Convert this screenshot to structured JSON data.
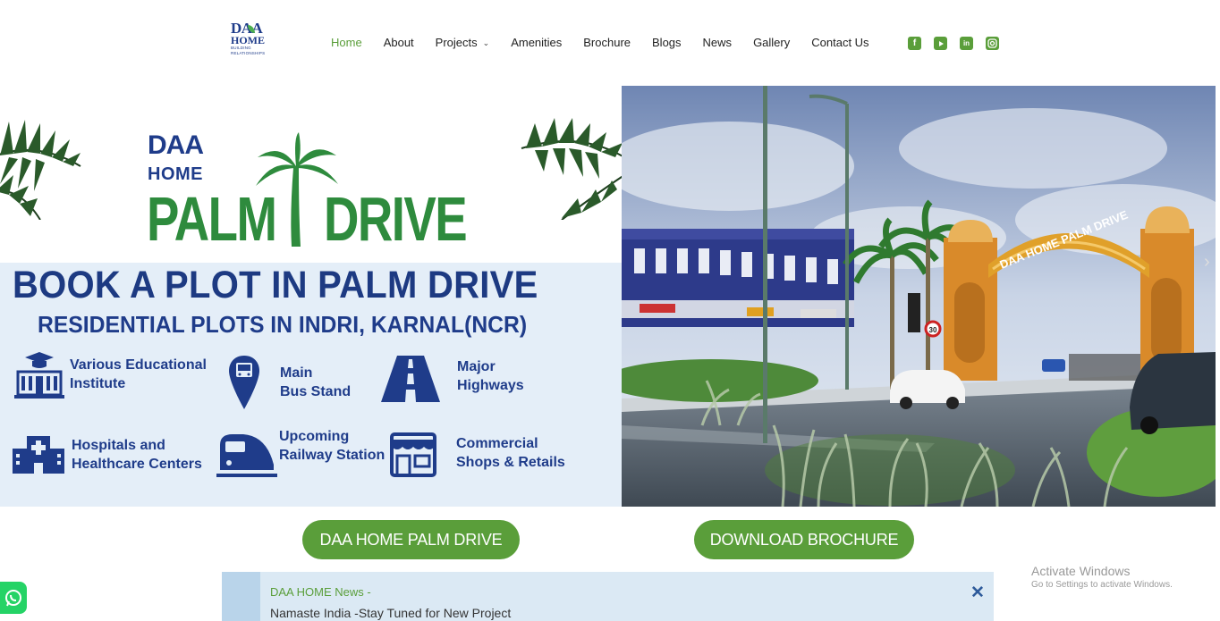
{
  "header": {
    "logo": {
      "line1": "DAA",
      "line2": "HOME",
      "tagline": "BUILDING RELATIONSHIPS"
    },
    "nav": [
      {
        "label": "Home",
        "active": true
      },
      {
        "label": "About"
      },
      {
        "label": "Projects",
        "dropdown": true
      },
      {
        "label": "Amenities"
      },
      {
        "label": "Brochure"
      },
      {
        "label": "Blogs"
      },
      {
        "label": "News"
      },
      {
        "label": "Gallery"
      },
      {
        "label": "Contact Us"
      }
    ],
    "social_icons": [
      "facebook-icon",
      "youtube-icon",
      "linkedin-icon",
      "instagram-icon"
    ],
    "accent_color": "#5a9e3a"
  },
  "banner": {
    "brand_top": "DAA",
    "brand_home": "HOME",
    "brand_palm": "PALM",
    "brand_drive": "DRIVE",
    "headline": "BOOK A PLOT IN PALM DRIVE",
    "subheadline": "RESIDENTIAL PLOTS IN INDRI, KARNAL(NCR)",
    "features": [
      {
        "icon": "school-icon",
        "line1": "Various Educational",
        "line2": "Institute"
      },
      {
        "icon": "bus-stand-icon",
        "line1": "Main",
        "line2": "Bus Stand"
      },
      {
        "icon": "highway-icon",
        "line1": "Major",
        "line2": "Highways"
      },
      {
        "icon": "hospital-icon",
        "line1": "Hospitals and",
        "line2": "Healthcare Centers"
      },
      {
        "icon": "train-icon",
        "line1": "Upcoming",
        "line2": "Railway Station"
      },
      {
        "icon": "shop-icon",
        "line1": "Commercial",
        "line2": "Shops & Retails"
      }
    ],
    "gate_sign": "DAA HOME PALM DRIVE",
    "speed_sign": "30"
  },
  "cta": {
    "primary": "DAA HOME PALM DRIVE",
    "secondary": "DOWNLOAD BROCHURE"
  },
  "news": {
    "title": "DAA HOME News -",
    "text": "Namaste India -Stay Tuned for New Project",
    "close": "✕"
  },
  "watermark": {
    "line1": "Activate Windows",
    "line2": "Go to Settings to activate Windows."
  }
}
